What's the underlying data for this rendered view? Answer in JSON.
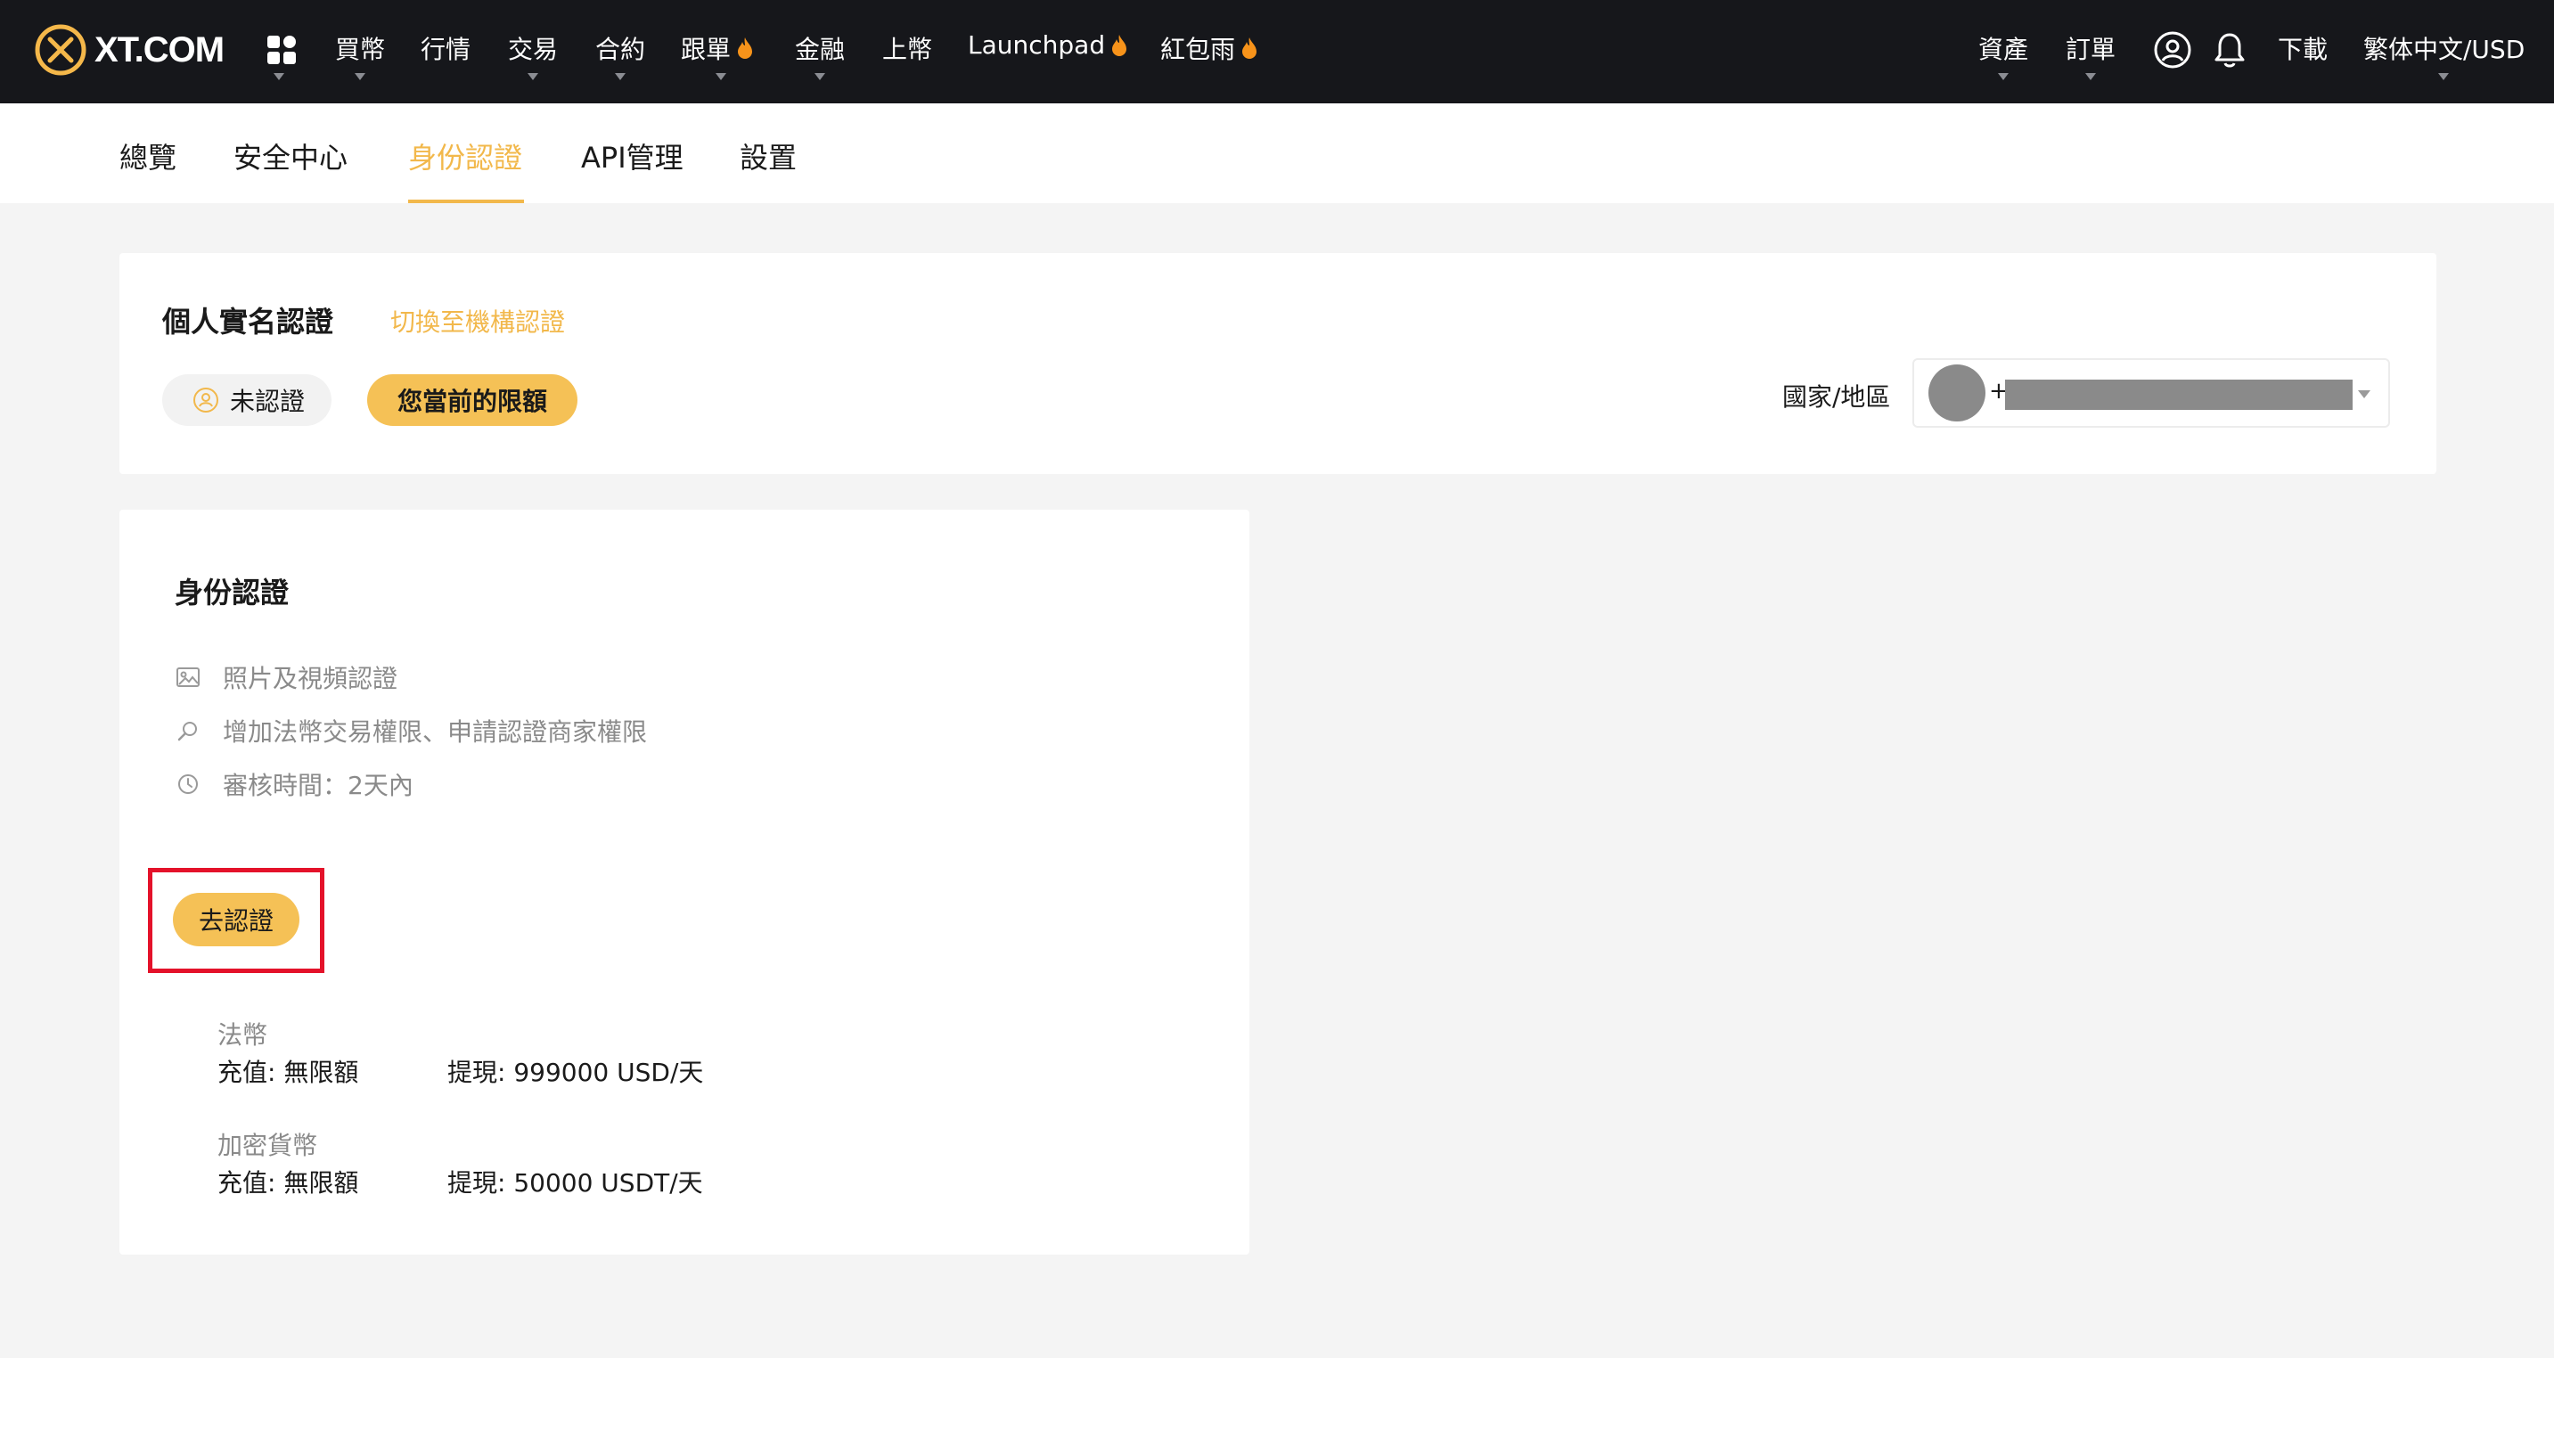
{
  "topbar": {
    "logo_text": "XT.COM",
    "nav": [
      {
        "label": "買幣",
        "has_caret": true,
        "hot": false
      },
      {
        "label": "行情",
        "has_caret": false,
        "hot": false
      },
      {
        "label": "交易",
        "has_caret": true,
        "hot": false
      },
      {
        "label": "合約",
        "has_caret": true,
        "hot": false
      },
      {
        "label": "跟單",
        "has_caret": true,
        "hot": true
      },
      {
        "label": "金融",
        "has_caret": true,
        "hot": false
      },
      {
        "label": "上幣",
        "has_caret": false,
        "hot": false
      },
      {
        "label": "Launchpad",
        "has_caret": false,
        "hot": true
      },
      {
        "label": "紅包雨",
        "has_caret": false,
        "hot": true
      }
    ],
    "right": {
      "assets": "資產",
      "orders": "訂單",
      "download": "下載",
      "locale": "繁体中文/USD"
    },
    "icons": [
      "apps-grid-icon",
      "user-circle-icon",
      "bell-icon",
      "fire-icon"
    ]
  },
  "subnav": {
    "tabs": [
      "總覽",
      "安全中心",
      "身份認證",
      "API管理",
      "設置"
    ],
    "active_index": 2
  },
  "kyc_header": {
    "title": "個人實名認證",
    "switch_link": "切換至機構認證",
    "status_label": "未認證",
    "limit_button": "您當前的限額",
    "country_label": "國家/地區",
    "country_prefix": "+"
  },
  "identity": {
    "title": "身份認證",
    "features": [
      {
        "icon": "image-icon",
        "text": "照片及視頻認證"
      },
      {
        "icon": "search-icon",
        "text": "增加法幣交易權限、申請認證商家權限"
      },
      {
        "icon": "clock-icon",
        "text": "審核時間：2天內"
      }
    ],
    "go_button": "去認證",
    "limits": [
      {
        "heading": "法幣",
        "deposit": "充值: 無限額",
        "withdraw": "提現: 999000 USD/天"
      },
      {
        "heading": "加密貨幣",
        "deposit": "充值: 無限額",
        "withdraw": "提現: 50000 USDT/天"
      }
    ]
  },
  "colors": {
    "accent": "#f5c156",
    "accent_text": "#f2b84b",
    "topbar_bg": "#16171b",
    "page_bg": "#f4f4f4",
    "highlight": "#e4122a"
  }
}
